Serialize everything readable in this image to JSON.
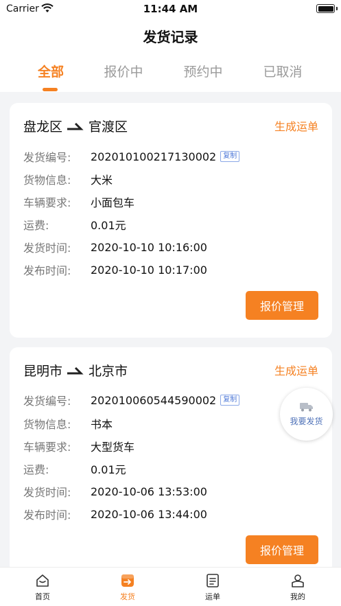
{
  "status_bar": {
    "carrier": "Carrier",
    "time": "11:44 AM"
  },
  "page_title": "发货记录",
  "tabs": [
    {
      "label": "全部",
      "active": true
    },
    {
      "label": "报价中",
      "active": false
    },
    {
      "label": "预约中",
      "active": false
    },
    {
      "label": "已取消",
      "active": false
    }
  ],
  "labels": {
    "shipment_no": "发货编号:",
    "goods_info": "货物信息:",
    "vehicle_req": "车辆要求:",
    "freight": "运费:",
    "ship_time": "发货时间:",
    "publish_time": "发布时间:"
  },
  "copy_label": "复制",
  "create_waybill_label": "生成运单",
  "quote_manage_label": "报价管理",
  "records": [
    {
      "from": "盘龙区",
      "to": "官渡区",
      "shipment_no": "202010100217130002",
      "goods": "大米",
      "vehicle": "小面包车",
      "freight": "0.01元",
      "ship_time": "2020-10-10 10:16:00",
      "publish_time": "2020-10-10 10:17:00"
    },
    {
      "from": "昆明市",
      "to": "北京市",
      "shipment_no": "202010060544590002",
      "goods": "书本",
      "vehicle": "大型货车",
      "freight": "0.01元",
      "ship_time": "2020-10-06 13:53:00",
      "publish_time": "2020-10-06 13:44:00"
    }
  ],
  "float_button": {
    "label": "我要发货",
    "icon": "truck-icon"
  },
  "bottom_nav": [
    {
      "label": "首页",
      "icon": "home-icon",
      "active": false
    },
    {
      "label": "发货",
      "icon": "ship-icon",
      "active": true
    },
    {
      "label": "运单",
      "icon": "waybill-icon",
      "active": false
    },
    {
      "label": "我的",
      "icon": "profile-icon",
      "active": false
    }
  ],
  "colors": {
    "accent": "#f58122",
    "link_blue": "#4f72b8",
    "background": "#f3f4f6"
  }
}
